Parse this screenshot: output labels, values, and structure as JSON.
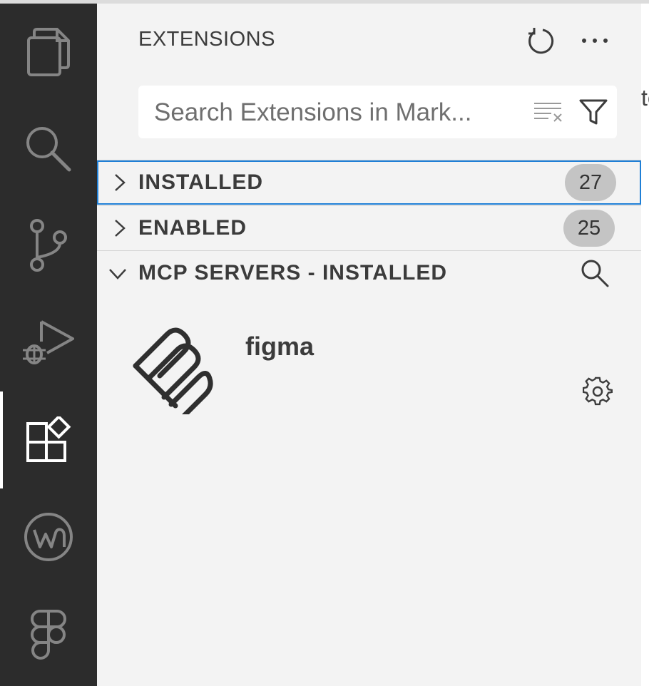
{
  "activity_bar": {
    "items": [
      {
        "icon": "files-icon"
      },
      {
        "icon": "search-icon"
      },
      {
        "icon": "source-control-icon"
      },
      {
        "icon": "run-debug-icon"
      },
      {
        "icon": "extensions-icon",
        "active": true
      },
      {
        "icon": "wallaby-icon"
      },
      {
        "icon": "figma-icon"
      }
    ]
  },
  "sidebar": {
    "title": "EXTENSIONS",
    "actions": [
      {
        "icon": "refresh-icon"
      },
      {
        "icon": "more-actions-icon"
      }
    ],
    "search": {
      "placeholder": "Search Extensions in Mark...",
      "value": "",
      "actions": [
        {
          "icon": "clear-search-results-icon"
        },
        {
          "icon": "filter-icon"
        }
      ]
    },
    "sections": [
      {
        "label": "INSTALLED",
        "count": "27",
        "expanded": false,
        "focused": true
      },
      {
        "label": "ENABLED",
        "count": "25",
        "expanded": false
      },
      {
        "label": "MCP SERVERS - INSTALLED",
        "expanded": true,
        "action_icon": "search-icon"
      }
    ],
    "mcp_servers": [
      {
        "name": "figma",
        "icon": "mcp-logo-icon",
        "action_icon": "gear-icon"
      }
    ]
  },
  "editor_peek": {
    "text": "te"
  },
  "colors": {
    "activity_bar_bg": "#2c2c2c",
    "sidebar_bg": "#f3f3f3",
    "focus_border": "#1f7fd6",
    "badge_bg": "#c4c4c4"
  }
}
